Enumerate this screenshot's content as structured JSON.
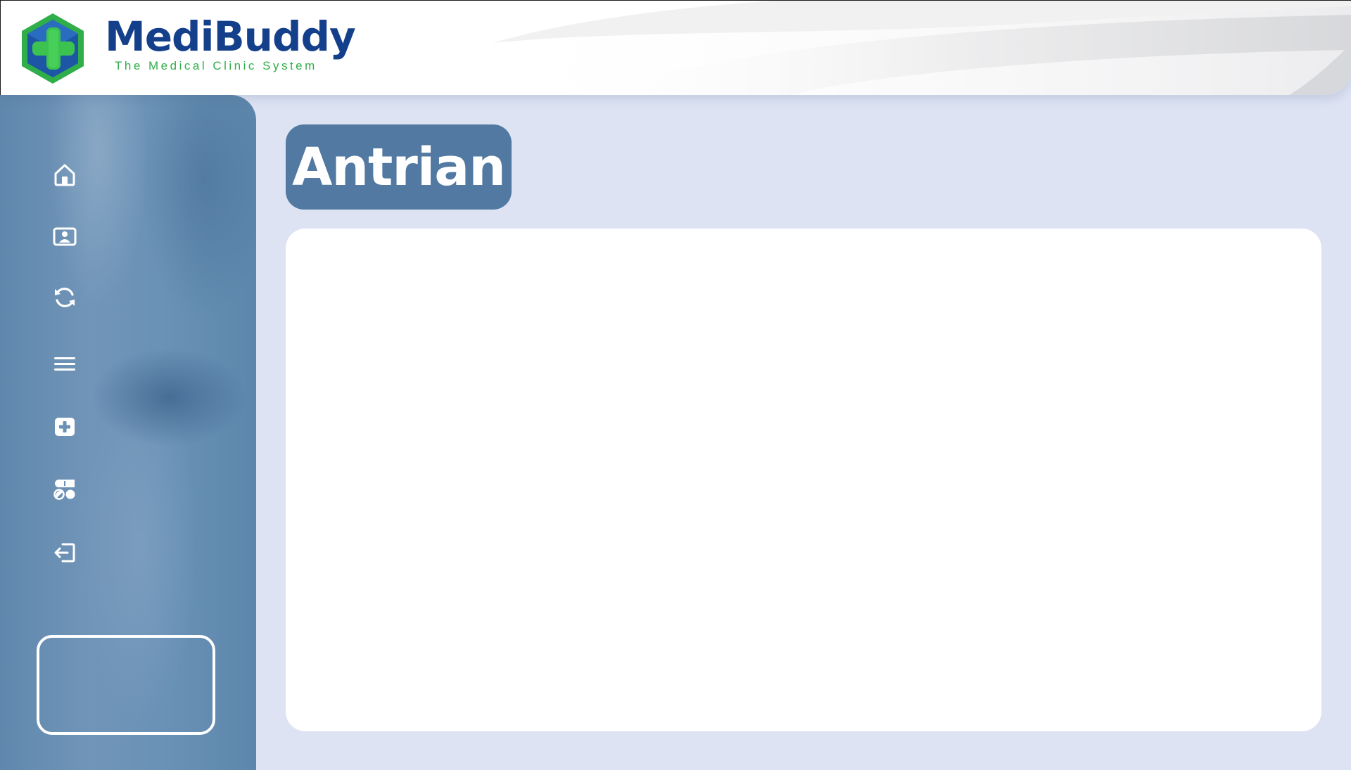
{
  "app": {
    "name": "MediBuddy",
    "tagline": "The Medical Clinic System"
  },
  "sidebar": {
    "items": [
      {
        "icon": "home-icon"
      },
      {
        "icon": "patient-card-icon"
      },
      {
        "icon": "refresh-icon"
      },
      {
        "icon": "list-menu-icon"
      },
      {
        "icon": "medical-plus-icon"
      },
      {
        "icon": "pharmacy-icon"
      },
      {
        "icon": "logout-icon"
      }
    ]
  },
  "main": {
    "title": "Antrian"
  },
  "colors": {
    "brand_blue": "#143f8a",
    "brand_green": "#2fae49",
    "title_pill": "#5279a2",
    "page_background": "#dde3f3",
    "card": "#ffffff"
  }
}
